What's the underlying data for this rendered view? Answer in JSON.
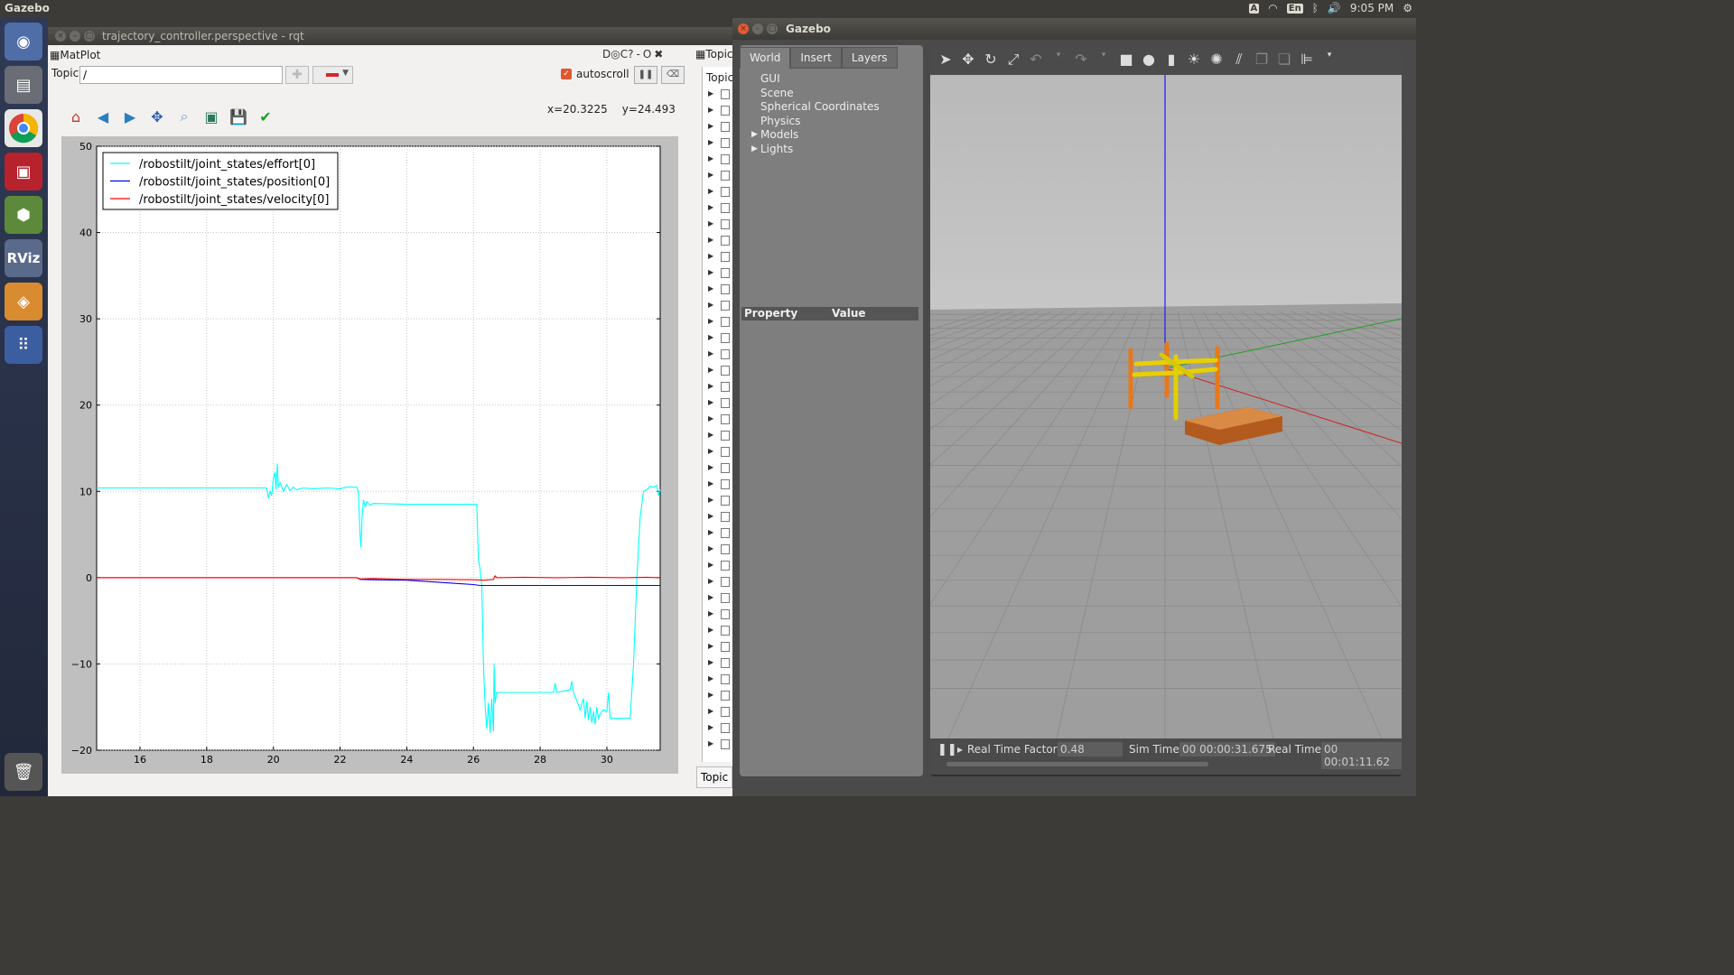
{
  "topbar": {
    "app_name": "Gazebo",
    "lang": "En",
    "time": "9:05 PM",
    "indicator_a": "A"
  },
  "rqt": {
    "window_title": "trajectory_controller.perspective - rqt",
    "matplot_label": "MatPlot",
    "topic_label": "Topic",
    "topic_value": "/",
    "autoscroll_label": "autoscroll",
    "coords_x": "x=20.3225",
    "coords_y": "y=24.493",
    "right_panel_title": "Topic",
    "topics_head": "Topic",
    "topic_bottom_label": "Topic",
    "dock_icons": "D◎C?",
    "dock_minus": "-",
    "dock_o": "O",
    "dock_close": "✖"
  },
  "chart_data": {
    "type": "line",
    "xlim": [
      14.7,
      31.6
    ],
    "ylim": [
      -20,
      50
    ],
    "xticks": [
      16,
      18,
      20,
      22,
      24,
      26,
      28,
      30
    ],
    "yticks": [
      -20,
      -10,
      0,
      10,
      20,
      30,
      40,
      50
    ],
    "legend_placement": "top-left",
    "grid": true,
    "series": [
      {
        "name": "/robostilt/joint_states/effort[0]",
        "color": "#00ffff",
        "points": [
          [
            14.7,
            10.4
          ],
          [
            19.8,
            10.4
          ],
          [
            19.85,
            9.2
          ],
          [
            19.9,
            10.0
          ],
          [
            19.95,
            9.5
          ],
          [
            20.0,
            11.5
          ],
          [
            20.05,
            12.2
          ],
          [
            20.08,
            10.2
          ],
          [
            20.12,
            13.2
          ],
          [
            20.15,
            10.5
          ],
          [
            20.2,
            11.0
          ],
          [
            20.3,
            10.0
          ],
          [
            20.4,
            10.8
          ],
          [
            20.5,
            10.1
          ],
          [
            20.6,
            10.5
          ],
          [
            20.7,
            10.2
          ],
          [
            20.9,
            10.4
          ],
          [
            21.2,
            10.3
          ],
          [
            21.6,
            10.4
          ],
          [
            22.0,
            10.3
          ],
          [
            22.2,
            10.5
          ],
          [
            22.5,
            10.5
          ],
          [
            22.55,
            10.0
          ],
          [
            22.6,
            5.0
          ],
          [
            22.63,
            3.5
          ],
          [
            22.66,
            7.0
          ],
          [
            22.7,
            9.0
          ],
          [
            22.75,
            8.2
          ],
          [
            22.8,
            8.8
          ],
          [
            22.9,
            8.4
          ],
          [
            23.0,
            8.6
          ],
          [
            24.0,
            8.5
          ],
          [
            25.0,
            8.5
          ],
          [
            26.1,
            8.5
          ],
          [
            26.15,
            2.0
          ],
          [
            26.2,
            1.0
          ],
          [
            26.25,
            -1.0
          ],
          [
            26.3,
            -10.0
          ],
          [
            26.35,
            -15.0
          ],
          [
            26.4,
            -17.5
          ],
          [
            26.45,
            -14.5
          ],
          [
            26.5,
            -18.0
          ],
          [
            26.55,
            -14.0
          ],
          [
            26.6,
            -17.8
          ],
          [
            26.62,
            -10.0
          ],
          [
            26.65,
            -14.5
          ],
          [
            26.7,
            -13.3
          ],
          [
            27.0,
            -13.3
          ],
          [
            27.5,
            -13.3
          ],
          [
            28.0,
            -13.3
          ],
          [
            28.4,
            -13.3
          ],
          [
            28.45,
            -12.2
          ],
          [
            28.5,
            -13.3
          ],
          [
            28.9,
            -13.0
          ],
          [
            28.95,
            -12.0
          ],
          [
            29.0,
            -13.3
          ],
          [
            29.1,
            -14.3
          ],
          [
            29.2,
            -15.3
          ],
          [
            29.3,
            -14.0
          ],
          [
            29.35,
            -16.3
          ],
          [
            29.4,
            -14.3
          ],
          [
            29.45,
            -16.5
          ],
          [
            29.5,
            -15.0
          ],
          [
            29.55,
            -16.8
          ],
          [
            29.6,
            -15.5
          ],
          [
            29.65,
            -17.0
          ],
          [
            29.7,
            -15.0
          ],
          [
            29.75,
            -16.3
          ],
          [
            29.8,
            -15.8
          ],
          [
            29.9,
            -15.3
          ],
          [
            30.0,
            -15.5
          ],
          [
            30.05,
            -13.3
          ],
          [
            30.1,
            -16.3
          ],
          [
            30.5,
            -16.3
          ],
          [
            30.7,
            -16.3
          ],
          [
            30.8,
            -10.0
          ],
          [
            30.9,
            0.0
          ],
          [
            31.0,
            7.0
          ],
          [
            31.1,
            10.0
          ],
          [
            31.2,
            10.2
          ],
          [
            31.3,
            10.6
          ],
          [
            31.4,
            10.5
          ],
          [
            31.5,
            10.7
          ],
          [
            31.55,
            9.5
          ],
          [
            31.6,
            10.2
          ]
        ]
      },
      {
        "name": "/robostilt/joint_states/position[0]",
        "color": "#0000ff",
        "points": [
          [
            14.7,
            0.0
          ],
          [
            22.5,
            0.0
          ],
          [
            22.6,
            -0.2
          ],
          [
            23.0,
            -0.25
          ],
          [
            24.0,
            -0.3
          ],
          [
            25.0,
            -0.55
          ],
          [
            26.0,
            -0.8
          ],
          [
            26.2,
            -0.9
          ],
          [
            27.0,
            -0.9
          ],
          [
            29.0,
            -0.9
          ],
          [
            31.6,
            -0.9
          ]
        ]
      },
      {
        "name": "/robostilt/joint_states/velocity[0]",
        "color": "#ff0000",
        "points": [
          [
            14.7,
            0.0
          ],
          [
            22.5,
            0.0
          ],
          [
            22.6,
            -0.15
          ],
          [
            23.0,
            -0.1
          ],
          [
            24.0,
            -0.2
          ],
          [
            25.0,
            -0.2
          ],
          [
            26.0,
            -0.25
          ],
          [
            26.3,
            -0.3
          ],
          [
            26.6,
            -0.2
          ],
          [
            26.65,
            0.2
          ],
          [
            26.7,
            0.0
          ],
          [
            27.5,
            0.05
          ],
          [
            28.5,
            0.0
          ],
          [
            29.5,
            0.05
          ],
          [
            30.5,
            0.0
          ],
          [
            31.2,
            0.05
          ],
          [
            31.6,
            0.0
          ]
        ]
      }
    ]
  },
  "gazebo": {
    "window_title": "Gazebo",
    "tabs": [
      "World",
      "Insert",
      "Layers"
    ],
    "tree": [
      "GUI",
      "Scene",
      "Spherical Coordinates",
      "Physics",
      "Models",
      "Lights"
    ],
    "property_col": "Property",
    "value_col": "Value",
    "rtf_label": "Real Time Factor:",
    "rtf_value": "0.48",
    "sim_time_label": "Sim Time:",
    "sim_time_value": "00 00:00:31.675",
    "real_time_label": "Real Time:",
    "real_time_value": "00 00:01:11.62"
  }
}
